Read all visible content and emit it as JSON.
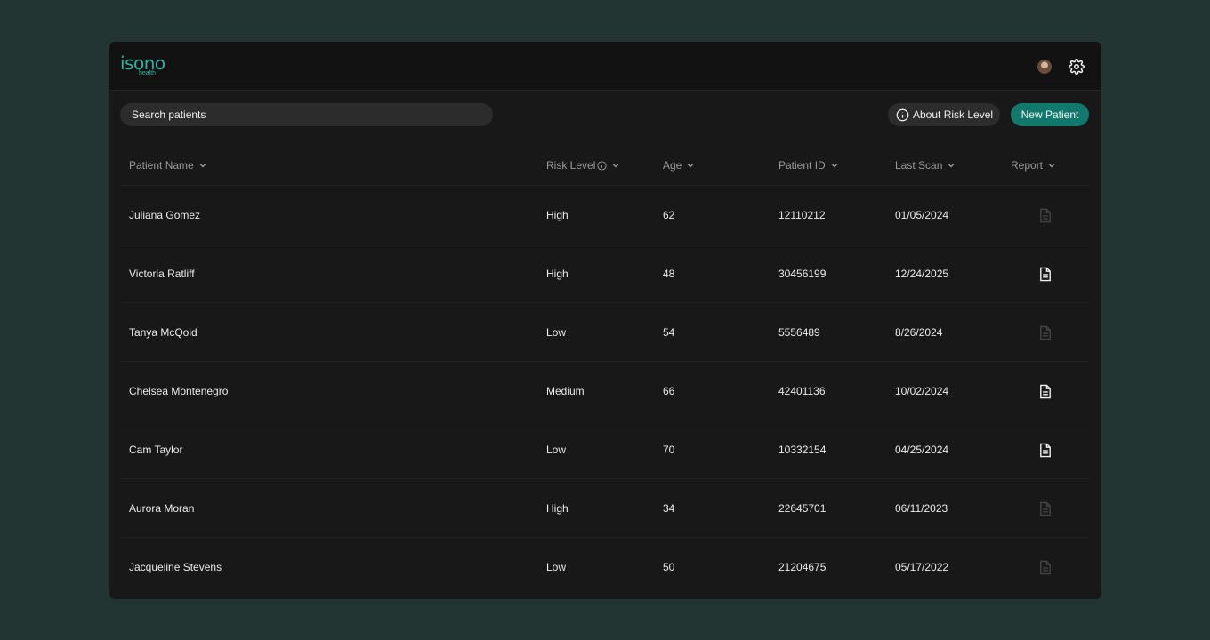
{
  "brand": {
    "name": "isono",
    "sub": "health"
  },
  "search": {
    "placeholder": "Search patients"
  },
  "buttons": {
    "about_risk": "About Risk Level",
    "new_patient": "New Patient"
  },
  "columns": [
    "Patient Name",
    "Risk Level",
    "Age",
    "Patient ID",
    "Last Scan",
    "Report"
  ],
  "rows": [
    {
      "name": "Juliana Gomez",
      "risk": "High",
      "age": "62",
      "id": "12110212",
      "scan": "01/05/2024",
      "report_available": false
    },
    {
      "name": "Victoria Ratliff",
      "risk": "High",
      "age": "48",
      "id": "30456199",
      "scan": "12/24/2025",
      "report_available": true
    },
    {
      "name": "Tanya McQoid",
      "risk": "Low",
      "age": "54",
      "id": "5556489",
      "scan": "8/26/2024",
      "report_available": false
    },
    {
      "name": "Chelsea Montenegro",
      "risk": "Medium",
      "age": "66",
      "id": "42401136",
      "scan": "10/02/2024",
      "report_available": true
    },
    {
      "name": "Cam Taylor",
      "risk": "Low",
      "age": "70",
      "id": "10332154",
      "scan": "04/25/2024",
      "report_available": true
    },
    {
      "name": "Aurora Moran",
      "risk": "High",
      "age": "34",
      "id": "22645701",
      "scan": "06/11/2023",
      "report_available": false
    },
    {
      "name": "Jacqueline Stevens",
      "risk": "Low",
      "age": "50",
      "id": "21204675",
      "scan": "05/17/2022",
      "report_available": false
    }
  ],
  "icons": {
    "avatar": "user-avatar",
    "settings": "gear-icon",
    "about": "info-circle-icon",
    "sort": "chevron-down-icon",
    "report": "document-icon"
  },
  "colors": {
    "background": "#223532",
    "accent": "#11786c",
    "brand": "#2bb3a3"
  }
}
